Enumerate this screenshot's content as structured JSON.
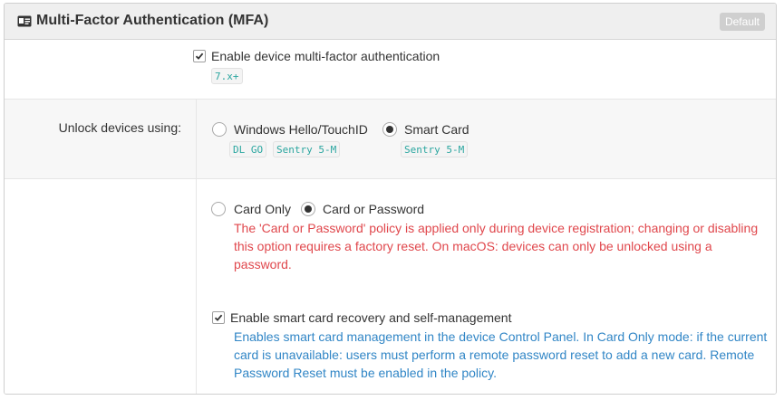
{
  "header": {
    "title": "Multi-Factor Authentication (MFA)",
    "badge": "Default",
    "icon": "id-card-icon"
  },
  "mfa": {
    "enable_label": "Enable device multi-factor authentication",
    "enable_checked": true,
    "version_tag": "7.x+"
  },
  "unlock": {
    "label": "Unlock devices using:",
    "options": [
      {
        "label": "Windows Hello/TouchID",
        "checked": false,
        "tags": [
          "DL GO",
          "Sentry 5-M"
        ]
      },
      {
        "label": "Smart Card",
        "checked": true,
        "tags": [
          "Sentry 5-M"
        ]
      }
    ]
  },
  "card_mode": {
    "options": [
      {
        "label": "Card Only",
        "checked": false
      },
      {
        "label": "Card or Password",
        "checked": true
      }
    ],
    "warning": "The 'Card or Password' policy is applied only during device registration; changing or disabling this option requires a factory reset. On macOS: devices can only be unlocked using a password."
  },
  "recovery": {
    "label": "Enable smart card recovery and self-management",
    "checked": true,
    "info": "Enables smart card management in the device Control Panel. In Card Only mode: if the current card is unavailable: users must perform a remote password reset to add a new card. Remote Password Reset must be enabled in the policy."
  },
  "colors": {
    "warning": "#e0474c",
    "info": "#3186c6",
    "tag_text": "#2ba6a0"
  }
}
